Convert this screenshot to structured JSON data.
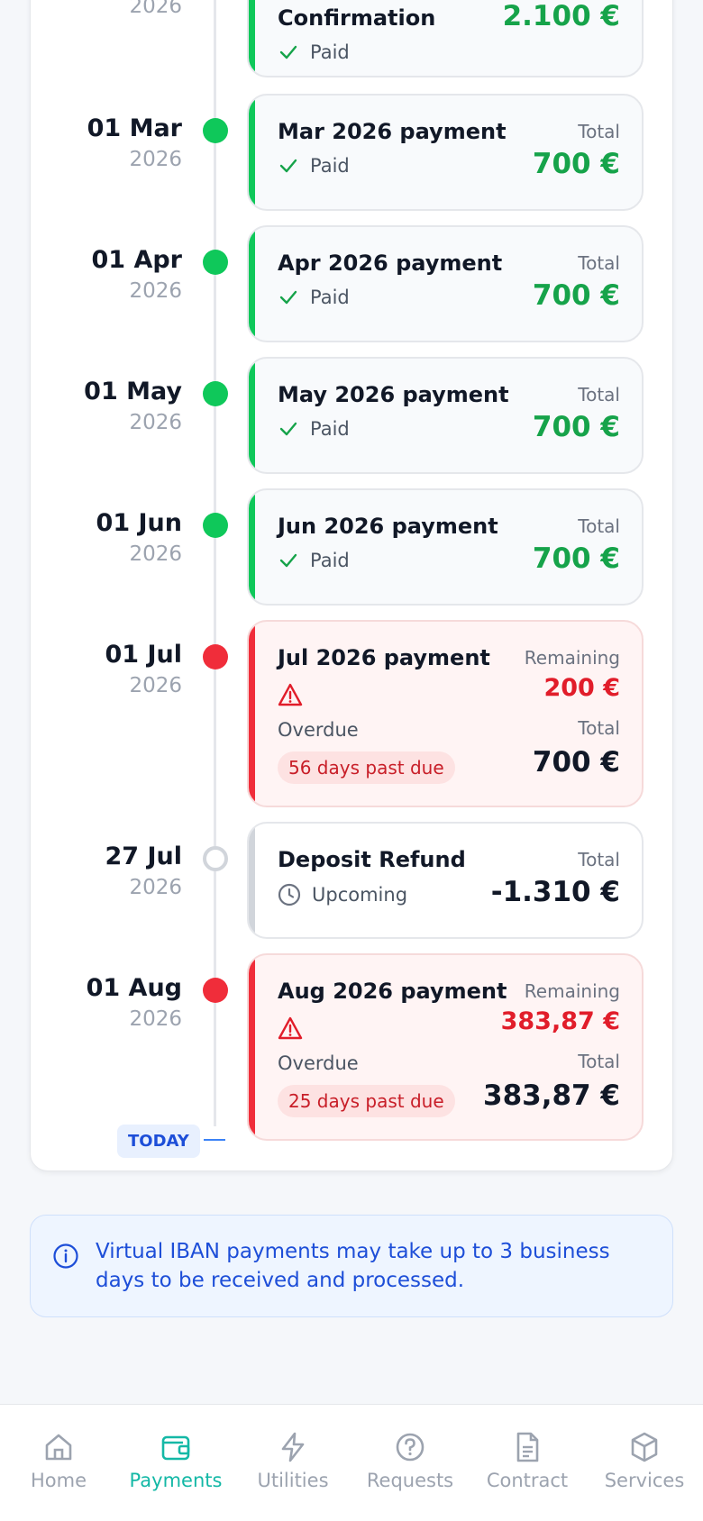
{
  "timeline": [
    {
      "day": "",
      "year": "2026",
      "title": "Confirmation",
      "status": "Paid",
      "right_label": "",
      "amount": "2.100 €"
    },
    {
      "day": "01 Mar",
      "year": "2026",
      "title": "Mar 2026 payment",
      "status": "Paid",
      "right_label": "Total",
      "amount": "700 €"
    },
    {
      "day": "01 Apr",
      "year": "2026",
      "title": "Apr 2026 payment",
      "status": "Paid",
      "right_label": "Total",
      "amount": "700 €"
    },
    {
      "day": "01 May",
      "year": "2026",
      "title": "May 2026 payment",
      "status": "Paid",
      "right_label": "Total",
      "amount": "700 €"
    },
    {
      "day": "01 Jun",
      "year": "2026",
      "title": "Jun 2026 payment",
      "status": "Paid",
      "right_label": "Total",
      "amount": "700 €"
    },
    {
      "day": "01 Jul",
      "year": "2026",
      "title": "Jul 2026 payment",
      "status": "Overdue",
      "remaining_label": "Remaining",
      "remaining": "200 €",
      "total_label": "Total",
      "total": "700 €",
      "badge": "56 days past due"
    },
    {
      "day": "27 Jul",
      "year": "2026",
      "title": "Deposit Refund",
      "status": "Upcoming",
      "right_label": "Total",
      "amount": "-1.310 €"
    },
    {
      "day": "01 Aug",
      "year": "2026",
      "title": "Aug 2026 payment",
      "status": "Overdue",
      "remaining_label": "Remaining",
      "remaining": "383,87 €",
      "total_label": "Total",
      "total": "383,87 €",
      "badge": "25 days past due"
    }
  ],
  "today_label": "TODAY",
  "info": {
    "text": "Virtual IBAN payments may take up to 3 business days to be received and processed."
  },
  "nav": {
    "home": "Home",
    "payments": "Payments",
    "utilities": "Utilities",
    "requests": "Requests",
    "contract": "Contract",
    "services": "Services"
  },
  "colors": {
    "paid": "#0fc85a",
    "overdue": "#f02d3a",
    "accent": "#14b8a6",
    "info": "#1d4ed8"
  }
}
